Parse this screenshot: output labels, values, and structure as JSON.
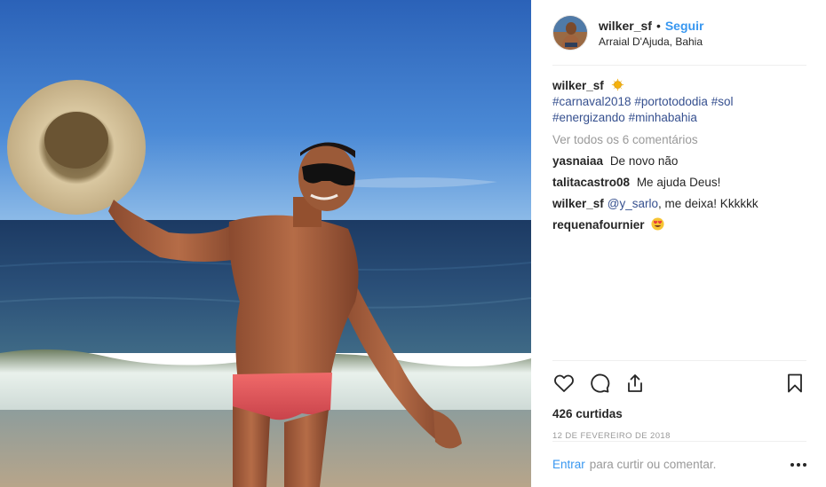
{
  "post": {
    "username": "wilker_sf",
    "separator": "•",
    "follow_label": "Seguir",
    "location": "Arraial D'Ajuda, Bahia"
  },
  "caption": {
    "username": "wilker_sf",
    "emoji": "sun-emoji",
    "hashtags": [
      "#carnaval2018",
      "#portotododia",
      "#sol",
      "#energizando",
      "#minhabahia"
    ]
  },
  "view_all": "Ver todos os 6 comentários",
  "comments": [
    {
      "username": "yasnaiaa",
      "text": "De novo não"
    },
    {
      "username": "talitacastro08",
      "text": "Me ajuda Deus!"
    },
    {
      "username": "wilker_sf",
      "mention": "@y_sarlo",
      "text": ", me deixa! Kkkkkk"
    },
    {
      "username": "requenafournier",
      "emoji": "heart-eyes-emoji"
    }
  ],
  "icons": {
    "like": "heart-icon",
    "comment": "comment-icon",
    "share": "share-icon",
    "save": "bookmark-icon",
    "more": "more-icon"
  },
  "likes": "426 curtidas",
  "date": "12 DE FEVEREIRO DE 2018",
  "add_comment": {
    "enter": "Entrar",
    "placeholder": "para curtir ou comentar."
  },
  "colors": {
    "link": "#3897f0",
    "hashtag": "#36508f",
    "muted": "#999999",
    "text": "#262626"
  }
}
